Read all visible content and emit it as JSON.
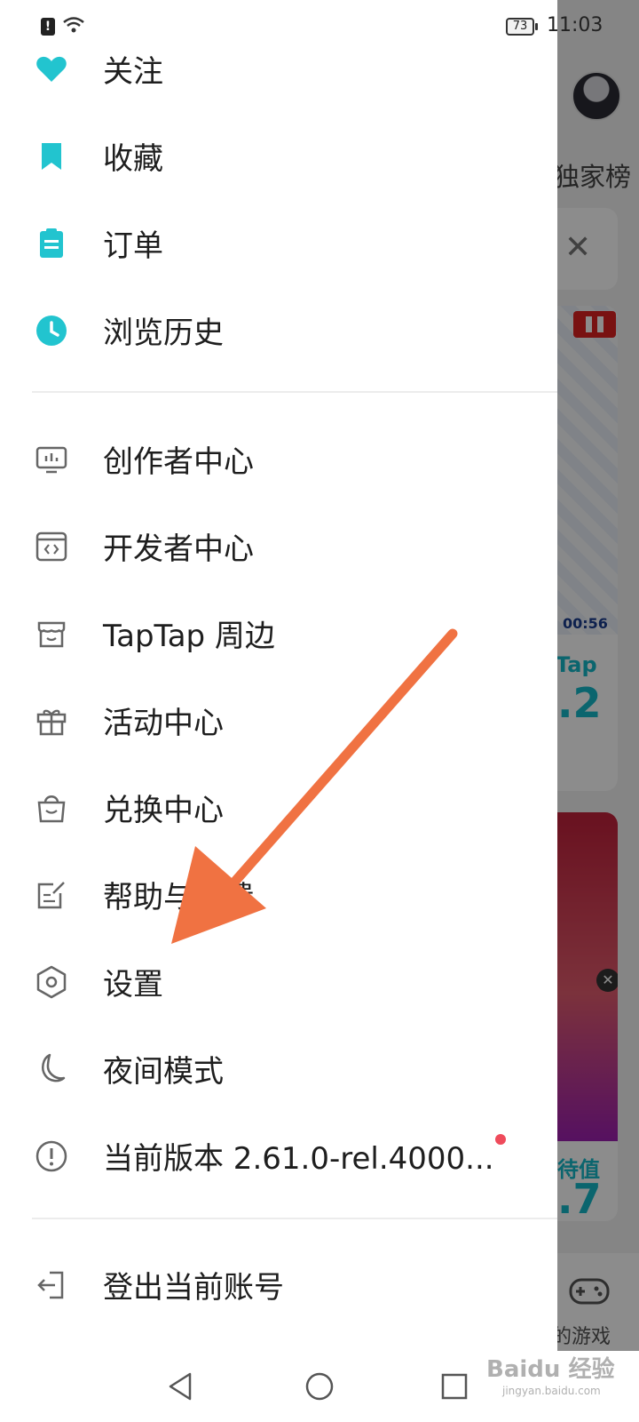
{
  "status_bar": {
    "time": "11:03",
    "battery": "73"
  },
  "drawer": {
    "section1": [
      {
        "key": "follow",
        "label": "关注",
        "icon": "heart-icon"
      },
      {
        "key": "favorites",
        "label": "收藏",
        "icon": "bookmark-icon"
      },
      {
        "key": "orders",
        "label": "订单",
        "icon": "clipboard-icon"
      },
      {
        "key": "history",
        "label": "浏览历史",
        "icon": "clock-icon"
      }
    ],
    "section2": [
      {
        "key": "creator",
        "label": "创作者中心",
        "icon": "monitor-chart-icon"
      },
      {
        "key": "developer",
        "label": "开发者中心",
        "icon": "code-window-icon"
      },
      {
        "key": "merch",
        "label": "TapTap 周边",
        "icon": "store-icon"
      },
      {
        "key": "events",
        "label": "活动中心",
        "icon": "gift-icon"
      },
      {
        "key": "redeem",
        "label": "兑换中心",
        "icon": "shopping-bag-icon"
      },
      {
        "key": "help",
        "label": "帮助与反馈",
        "icon": "edit-note-icon"
      },
      {
        "key": "settings",
        "label": "设置",
        "icon": "hexagon-settings-icon"
      },
      {
        "key": "night",
        "label": "夜间模式",
        "icon": "moon-icon"
      },
      {
        "key": "version",
        "label": "当前版本 2.61.0-rel.4000...",
        "icon": "info-circle-icon"
      }
    ],
    "logout": {
      "label": "登出当前账号",
      "icon": "logout-icon"
    }
  },
  "background": {
    "tab_text": "独家榜",
    "video_time": "00:56",
    "brand_fragment": "Tap",
    "score1": ".2",
    "tag_fragment": "待值",
    "score2": ".7",
    "bottom_label": "的游戏"
  },
  "watermark": {
    "text": "Baidu 经验",
    "sub": "jingyan.baidu.com"
  },
  "colors": {
    "accent": "#22c4cf",
    "arrow": "#f07242",
    "badge": "#ef4b5b"
  }
}
